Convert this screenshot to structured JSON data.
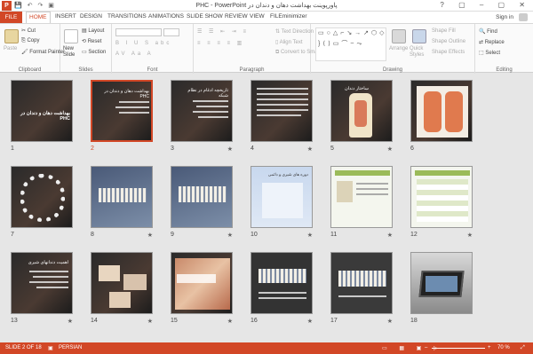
{
  "titlebar": {
    "app_icon": "P",
    "title": "PHC - PowerPoint پاورپوینت بهداشت دهان و دندان در",
    "sign_in": "Sign in",
    "qat_icons": [
      "save-icon",
      "undo-icon",
      "redo-icon",
      "present-icon"
    ]
  },
  "tabs": [
    "FILE",
    "HOME",
    "INSERT",
    "DESIGN",
    "TRANSITIONS",
    "ANIMATIONS",
    "SLIDE SHOW",
    "REVIEW",
    "VIEW",
    "FILEminimizer"
  ],
  "ribbon": {
    "clipboard": {
      "label": "Clipboard",
      "paste": "Paste",
      "cut": "Cut",
      "copy": "Copy",
      "format_painter": "Format Painter"
    },
    "slides": {
      "label": "Slides",
      "new_slide": "New Slide",
      "layout": "Layout",
      "reset": "Reset",
      "section": "Section"
    },
    "font": {
      "label": "Font"
    },
    "paragraph": {
      "label": "Paragraph",
      "text_direction": "Text Direction",
      "align_text": "Align Text",
      "convert": "Convert to SmartArt"
    },
    "drawing": {
      "label": "Drawing",
      "arrange": "Arrange",
      "quick_styles": "Quick Styles",
      "shape_fill": "Shape Fill",
      "shape_outline": "Shape Outline",
      "shape_effects": "Shape Effects"
    },
    "editing": {
      "label": "Editing",
      "find": "Find",
      "replace": "Replace",
      "select": "Select"
    }
  },
  "slides": [
    {
      "n": "1",
      "star": "",
      "title": "بهداشت دهان و دندان در PHC",
      "style": "dark"
    },
    {
      "n": "2",
      "star": "",
      "title": "بهداشت دهان و دندان در PHC",
      "style": "dark",
      "selected": true
    },
    {
      "n": "3",
      "star": "★",
      "title": "تاریخچه ادغام در نظام شبکه",
      "style": "dark"
    },
    {
      "n": "4",
      "star": "★",
      "title": "",
      "style": "dark"
    },
    {
      "n": "5",
      "star": "★",
      "title": "ساختار دندان",
      "style": "dark"
    },
    {
      "n": "6",
      "star": "",
      "title": "",
      "style": "dark"
    },
    {
      "n": "7",
      "star": "",
      "title": "",
      "style": "dark"
    },
    {
      "n": "8",
      "star": "★",
      "title": "",
      "style": "blue"
    },
    {
      "n": "9",
      "star": "★",
      "title": "",
      "style": "blue"
    },
    {
      "n": "10",
      "star": "★",
      "title": "دوره های شیری و دائمی",
      "style": "sky"
    },
    {
      "n": "11",
      "star": "★",
      "title": "",
      "style": "light"
    },
    {
      "n": "12",
      "star": "★",
      "title": "",
      "style": "light"
    },
    {
      "n": "13",
      "star": "★",
      "title": "اهمیت دندانهای شیری",
      "style": "dark"
    },
    {
      "n": "14",
      "star": "★",
      "title": "",
      "style": "dark"
    },
    {
      "n": "15",
      "star": "★",
      "title": "",
      "style": "dark"
    },
    {
      "n": "16",
      "star": "★",
      "title": "",
      "style": "blue"
    },
    {
      "n": "17",
      "star": "★",
      "title": "",
      "style": "blue"
    },
    {
      "n": "18",
      "star": "",
      "title": "",
      "style": "photo"
    }
  ],
  "status": {
    "slide_info": "SLIDE 2 OF 18",
    "language": "PERSIAN",
    "zoom": "70 %"
  }
}
